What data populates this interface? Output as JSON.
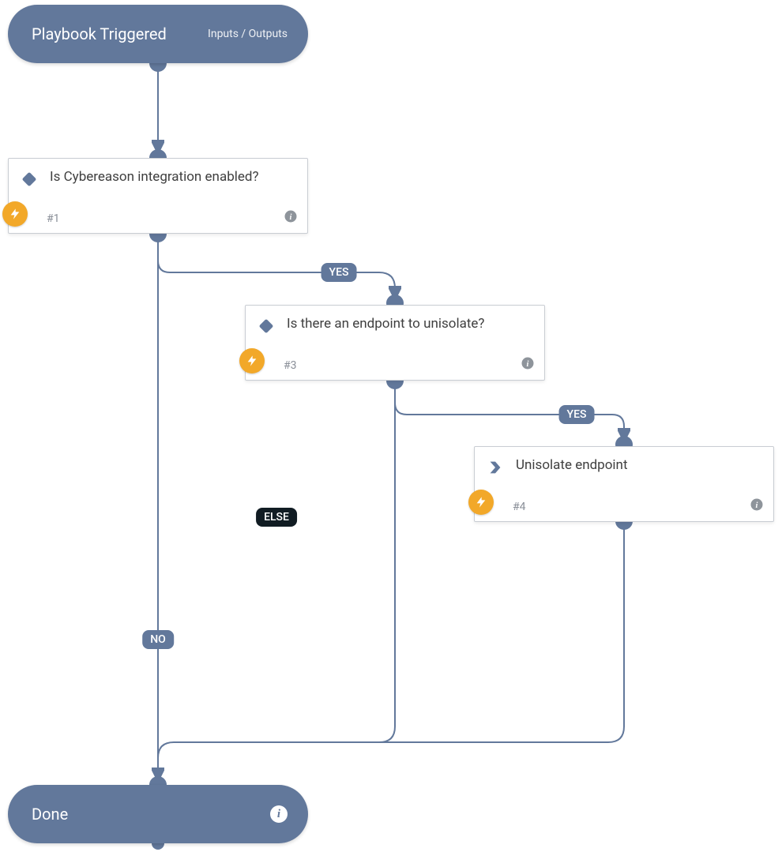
{
  "start": {
    "title": "Playbook Triggered",
    "right": "Inputs / Outputs"
  },
  "end": {
    "title": "Done"
  },
  "nodes": {
    "n1": {
      "label": "Is Cybereason integration enabled?",
      "id": "#1",
      "type": "condition"
    },
    "n3": {
      "label": "Is there an endpoint to unisolate?",
      "id": "#3",
      "type": "condition"
    },
    "n4": {
      "label": "Unisolate endpoint",
      "id": "#4",
      "type": "action"
    }
  },
  "edges": {
    "yes1": "YES",
    "yes2": "YES",
    "no": "NO",
    "else": "ELSE"
  }
}
